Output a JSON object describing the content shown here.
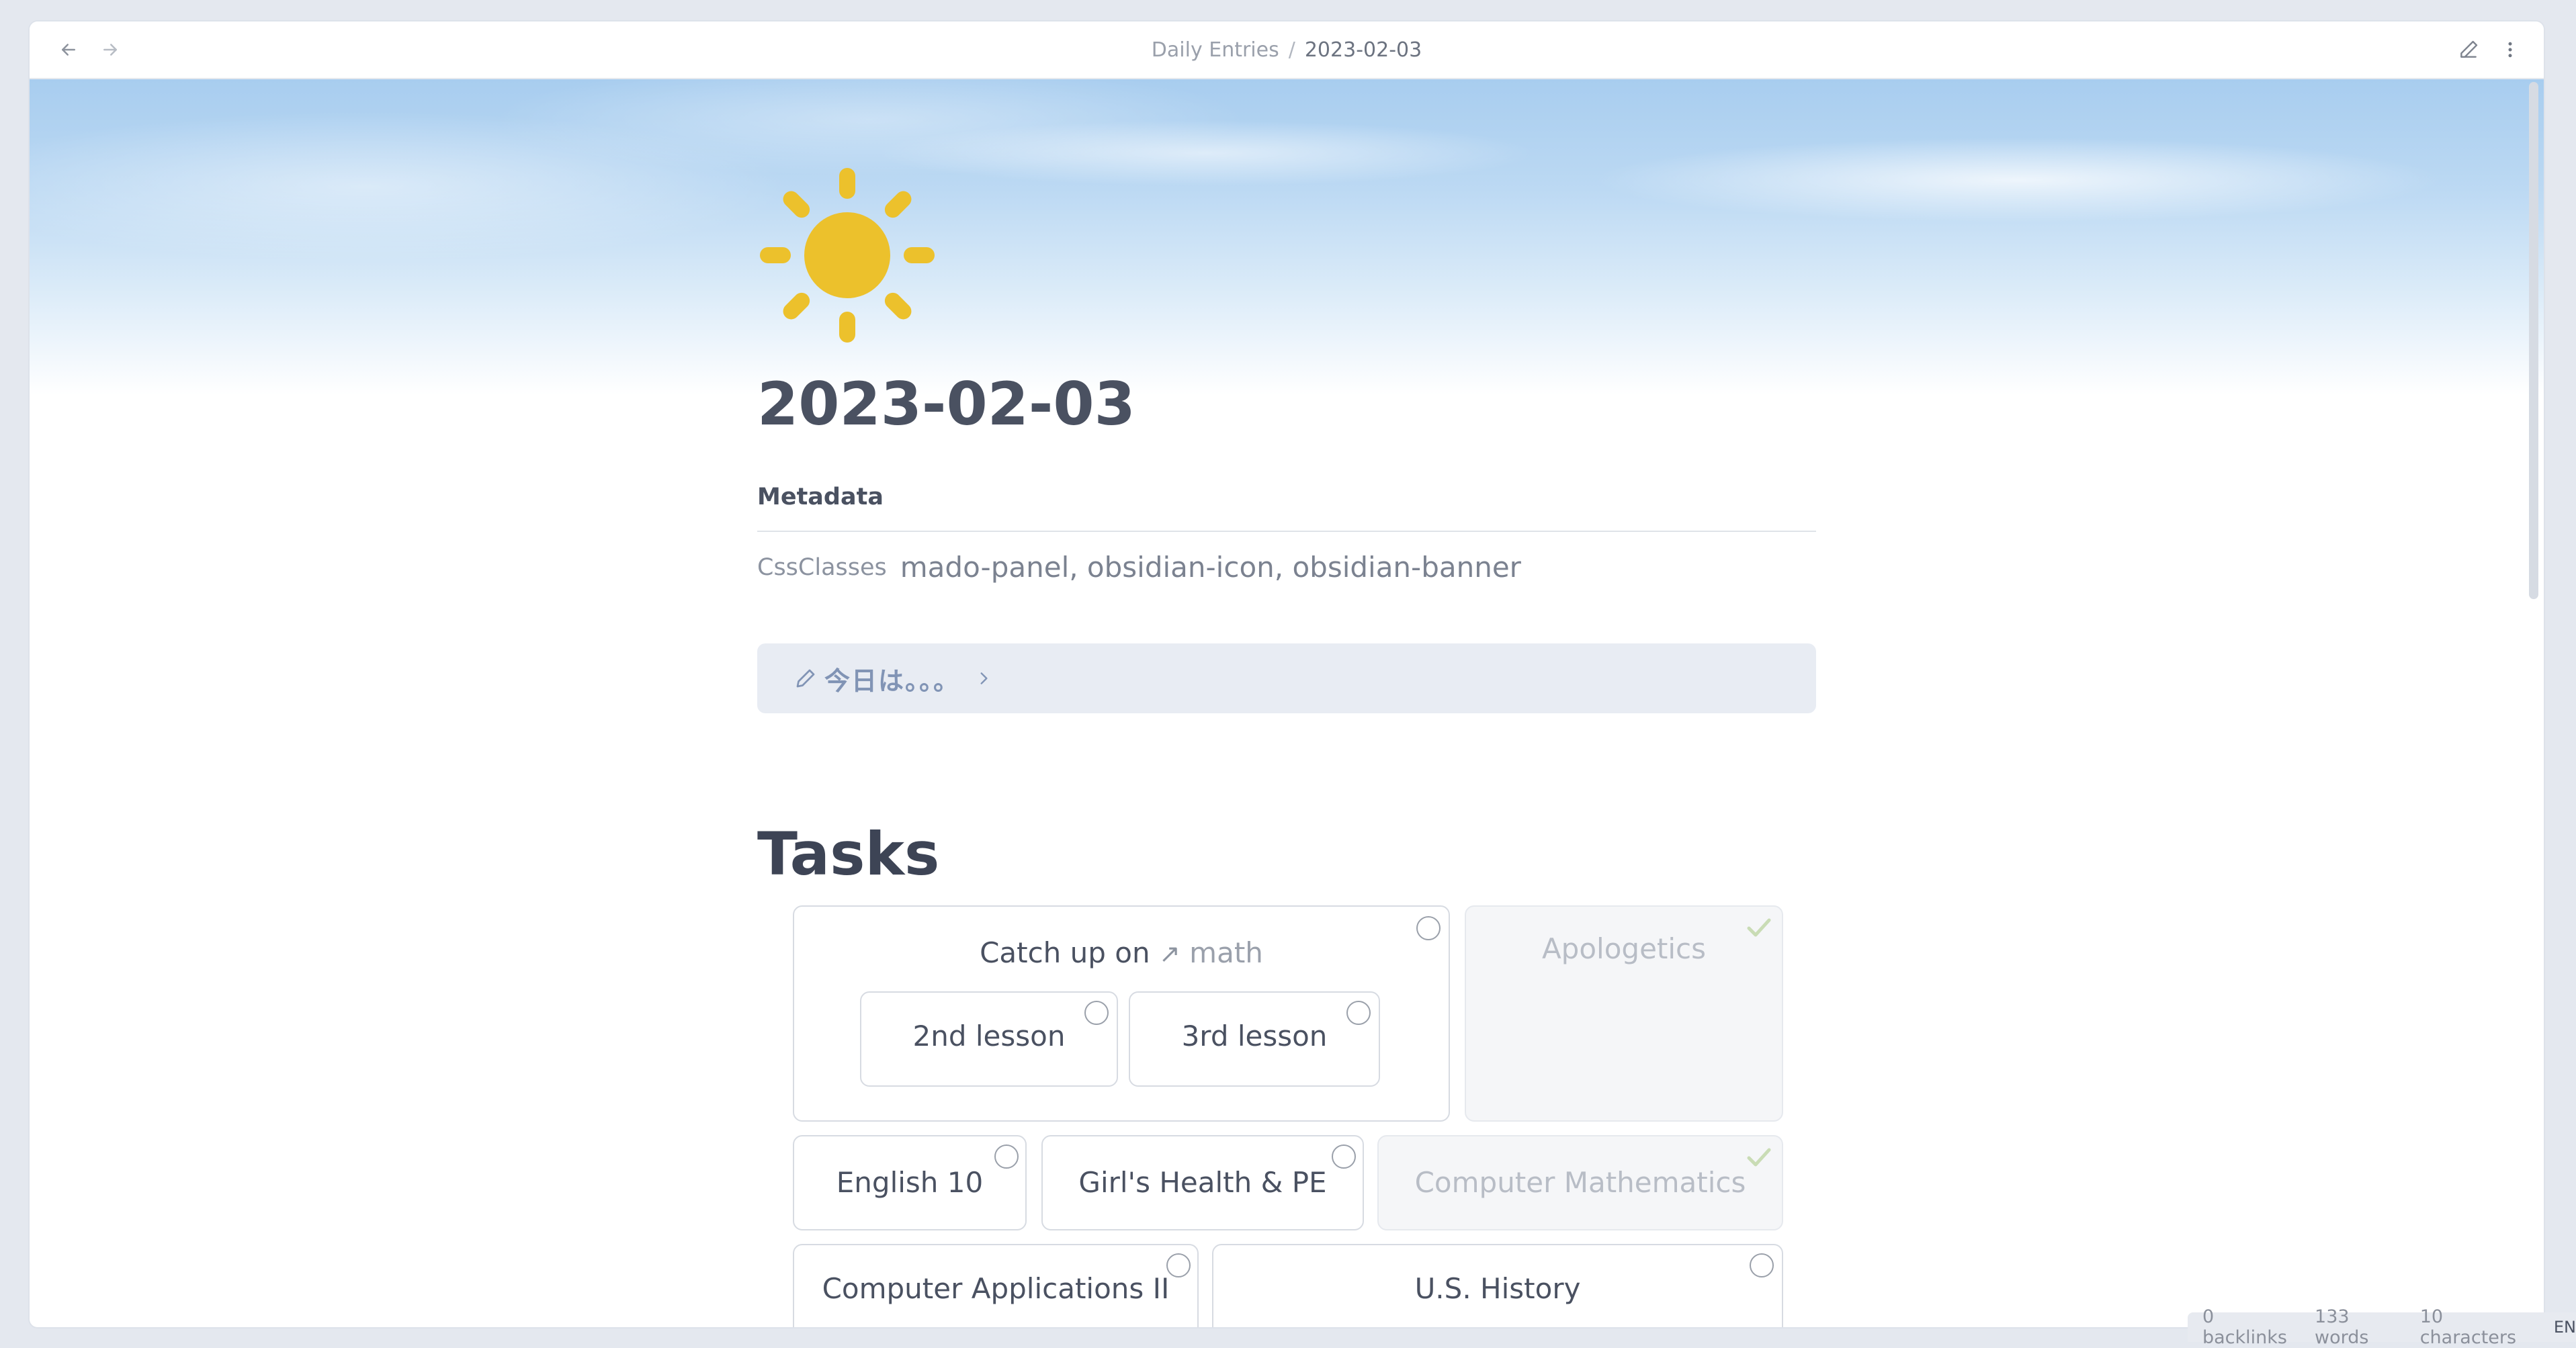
{
  "breadcrumb": {
    "parent": "Daily Entries",
    "separator": "/",
    "current": "2023-02-03"
  },
  "note": {
    "title": "2023-02-03",
    "icon": "sun-icon",
    "icon_color": "#ecc12c"
  },
  "metadata": {
    "heading": "Metadata",
    "key": "CssClasses",
    "value": "mado-panel, obsidian-icon, obsidian-banner"
  },
  "callout": {
    "text": "今日は。。。"
  },
  "tasks": {
    "heading": "Tasks",
    "catchup": {
      "prefix": "Catch up on",
      "link": "math",
      "subtasks": [
        "2nd lesson",
        "3rd lesson"
      ]
    },
    "apologetics": "Apologetics",
    "english": "English 10",
    "health": "Girl's Health & PE",
    "compmath": "Computer Mathematics",
    "compapps": "Computer Applications II",
    "history": "U.S. History"
  },
  "status": {
    "backlinks": "0 backlinks",
    "words": "133 words",
    "characters": "10 characters",
    "lang": "EN"
  },
  "colors": {
    "accent": "#8194b5",
    "done_check": "#c9dcb5"
  }
}
